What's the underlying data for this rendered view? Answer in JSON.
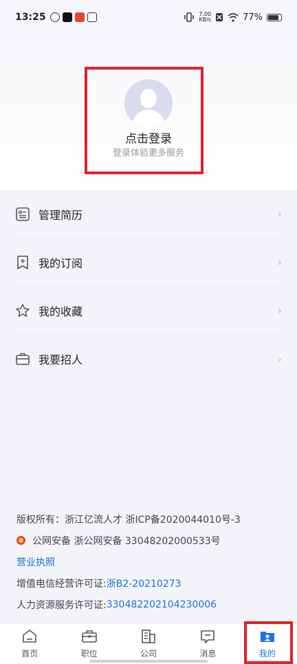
{
  "status_bar": {
    "time": "13:25",
    "network_speed_value": "7.00",
    "network_speed_unit": "KB/s",
    "battery_percent": "77%"
  },
  "profile": {
    "login_title": "点击登录",
    "login_subtitle": "登录体验更多服务"
  },
  "menu": {
    "items": [
      {
        "label": "管理简历",
        "icon": "resume-icon"
      },
      {
        "label": "我的订阅",
        "icon": "subscription-bookmark-icon"
      },
      {
        "label": "我的收藏",
        "icon": "star-icon"
      },
      {
        "label": "我要招人",
        "icon": "briefcase-icon"
      }
    ]
  },
  "footer": {
    "copyright": "版权所有：浙江亿流人才   浙ICP备2020044010号-3",
    "police_record": "公网安备 浙公网安备 33048202000533号",
    "business_license": "营业执照",
    "telecom_label": "增值电信经营许可证: ",
    "telecom_value": "浙B2-20210273",
    "hr_label": "人力资源服务许可证: ",
    "hr_value": "330482202104230006"
  },
  "tabbar": {
    "tabs": [
      {
        "label": "首页",
        "icon": "home-icon"
      },
      {
        "label": "职位",
        "icon": "briefcase-icon"
      },
      {
        "label": "公司",
        "icon": "building-icon"
      },
      {
        "label": "消息",
        "icon": "message-icon"
      },
      {
        "label": "我的",
        "icon": "user-folder-icon"
      }
    ],
    "active_index": 4
  },
  "colors": {
    "accent": "#1a73e8",
    "highlight": "#e3202a",
    "link": "#1a6fd8"
  }
}
